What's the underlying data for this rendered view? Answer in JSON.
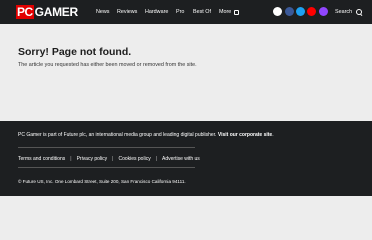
{
  "header": {
    "logo_pc": "PC",
    "logo_gamer": "GAMER",
    "nav": [
      "News",
      "Reviews",
      "Hardware",
      "Pro",
      "Best Of",
      "More"
    ],
    "search_label": "Search"
  },
  "social_colors": [
    "#ffffff",
    "#3b5998",
    "#1da1f2",
    "#ff0000",
    "#9146ff"
  ],
  "main": {
    "title": "Sorry! Page not found.",
    "message": "The article you requested has either been moved or removed from the site."
  },
  "footer": {
    "about_text": "PC Gamer is part of Future plc, an international media group and leading digital publisher. ",
    "about_link": "Visit our corporate site",
    "about_end": ".",
    "links": [
      "Terms and conditions",
      "Privacy policy",
      "Cookies policy",
      "Advertise with us"
    ],
    "copyright": "© Future US, Inc. One Lombard Street, Suite 200, San Francisco California 94111."
  }
}
